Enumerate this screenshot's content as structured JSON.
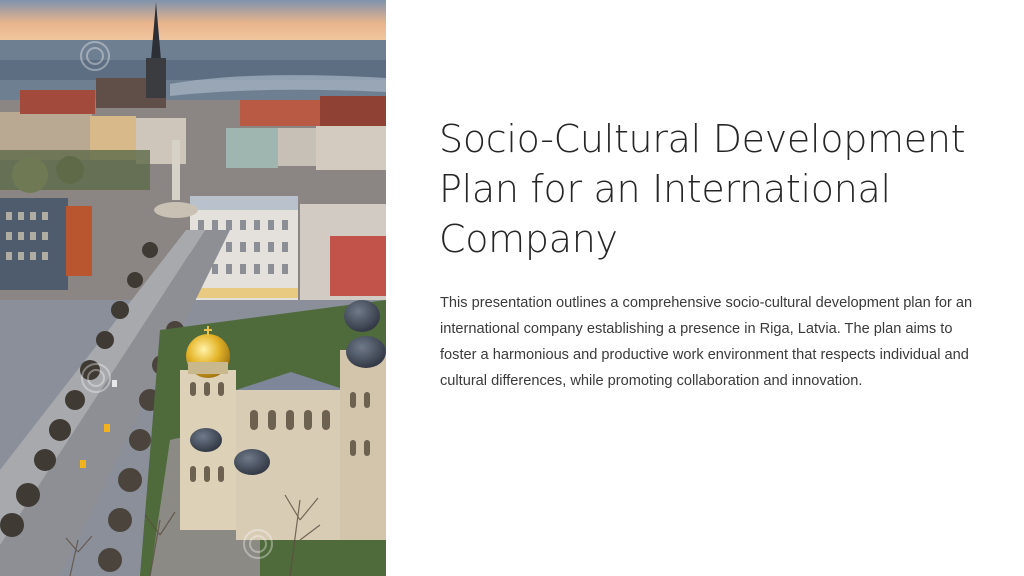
{
  "slide": {
    "title": "Socio-Cultural Development Plan for an International Company",
    "description": "This presentation outlines a comprehensive socio-cultural development plan for an international company establishing a presence in Riga, Latvia. The plan aims to foster a harmonious and productive work environment that respects individual and cultural differences, while promoting collaboration and innovation."
  },
  "colors": {
    "background": "#ffffff",
    "title": "#262626",
    "body": "#3a3a3a"
  }
}
